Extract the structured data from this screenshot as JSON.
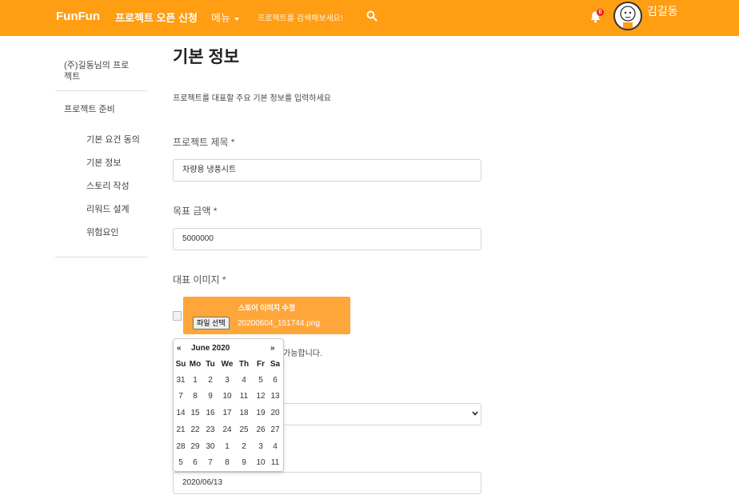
{
  "navbar": {
    "brand": "FunFun",
    "open_project": "프로젝트 오픈 신청",
    "menu": "메뉴",
    "search_placeholder": "프로젝트를 검색해보세요!",
    "notification_count": "0",
    "user_name": "김길동"
  },
  "sidebar": {
    "project_name": "(주)길동님의 프로젝트",
    "section": "프로젝트 준비",
    "items": [
      {
        "label": "기본 요건 동의"
      },
      {
        "label": "기본 정보"
      },
      {
        "label": "스토리 작성"
      },
      {
        "label": "리워드 설계"
      },
      {
        "label": "위험요인"
      }
    ]
  },
  "main": {
    "title": "기본 정보",
    "intro": "프로젝트를 대표할 주요 기본 정보를 입력하세요",
    "project_title_label": "프로젝트 제목",
    "project_title_value": "차량용 냉풍시트",
    "goal_label": "목표 금액",
    "goal_value": "5000000",
    "image_label": "대표 이미지",
    "required_mark": "*",
    "upload_title": "스토어 이미지 수정",
    "file_button": "파일 선택",
    "file_name": "20200604_151744.png",
    "hint_suffix": "가능합니다.",
    "date_value": "2020/06/13"
  },
  "datepicker": {
    "prev": "«",
    "next": "»",
    "month": "June 2020",
    "weekdays": [
      "Su",
      "Mo",
      "Tu",
      "We",
      "Th",
      "Fr",
      "Sa"
    ],
    "weeks": [
      [
        "31",
        "1",
        "2",
        "3",
        "4",
        "5",
        "6"
      ],
      [
        "7",
        "8",
        "9",
        "10",
        "11",
        "12",
        "13"
      ],
      [
        "14",
        "15",
        "16",
        "17",
        "18",
        "19",
        "20"
      ],
      [
        "21",
        "22",
        "23",
        "24",
        "25",
        "26",
        "27"
      ],
      [
        "28",
        "29",
        "30",
        "1",
        "2",
        "3",
        "4"
      ],
      [
        "5",
        "6",
        "7",
        "8",
        "9",
        "10",
        "11"
      ]
    ]
  },
  "colors": {
    "brand_orange": "#ff9d13",
    "upload_orange": "#ffa63a",
    "badge_red": "#e8221a"
  },
  "icons": {
    "search": "search-icon",
    "bell": "bell-icon",
    "avatar": "avatar-icon"
  }
}
